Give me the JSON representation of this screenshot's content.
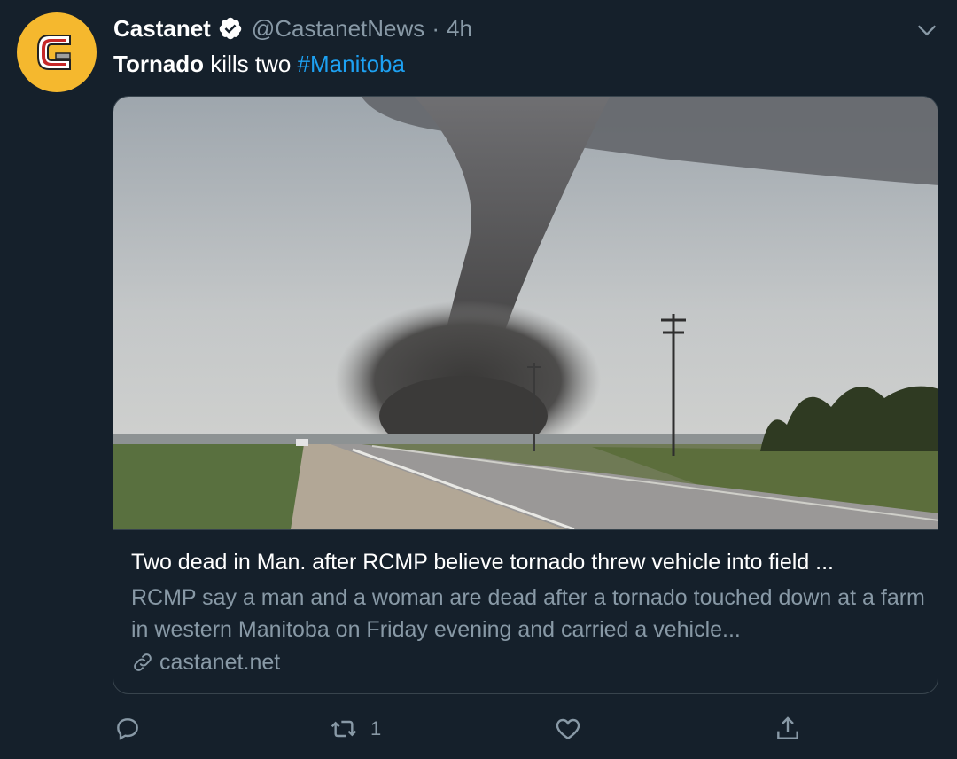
{
  "tweet": {
    "author_name": "Castanet",
    "handle": "@CastanetNews",
    "separator": "·",
    "time": "4h",
    "text_bold": "Tornado",
    "text_plain": " kills two ",
    "hashtag": "#Manitoba"
  },
  "card": {
    "title": "Two dead in Man. after RCMP believe tornado threw vehicle into field ...",
    "description": "RCMP say a man and a woman are dead after a tornado touched down at a farm in western Manitoba on Friday evening and carried a vehicle...",
    "domain": "castanet.net"
  },
  "actions": {
    "reply_count": "",
    "retweet_count": "1",
    "like_count": "",
    "share_count": ""
  },
  "icons": {
    "avatar": "castanet-logo-icon",
    "verified": "verified-badge-icon",
    "caret": "chevron-down-icon",
    "link": "link-icon",
    "reply": "reply-icon",
    "retweet": "retweet-icon",
    "like": "heart-icon",
    "share": "share-icon"
  },
  "colors": {
    "background": "#15202b",
    "accent": "#1da1f2",
    "secondary_text": "#8899a6",
    "border": "#38444d",
    "avatar_bg": "#f5b82e"
  }
}
